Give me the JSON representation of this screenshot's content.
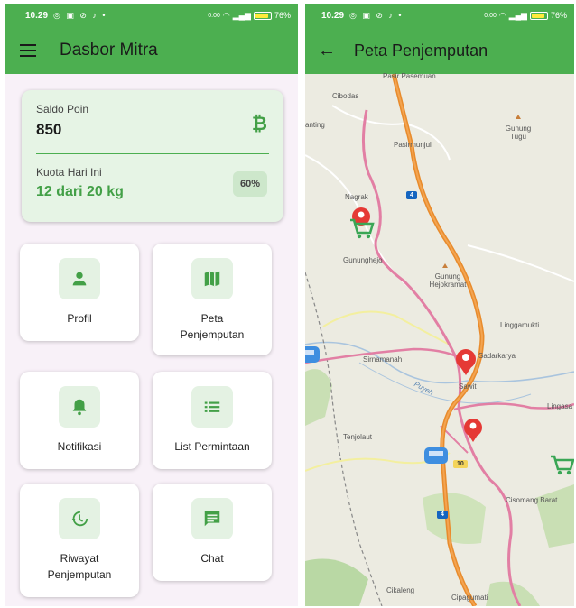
{
  "status_bar": {
    "time": "10.29",
    "network_speed": "0.00",
    "battery": "76%"
  },
  "left_screen": {
    "title": "Dasbor Mitra",
    "saldo": {
      "label": "Saldo Poin",
      "value": "850"
    },
    "quota": {
      "label": "Kuota Hari Ini",
      "value": "12 dari 20 kg",
      "percent_label": "60%",
      "percent": 0.6
    },
    "menu": [
      {
        "id": "profil",
        "label": "Profil",
        "icon": "person-icon"
      },
      {
        "id": "peta",
        "label": "Peta\nPenjemputan",
        "icon": "map-icon"
      },
      {
        "id": "notifikasi",
        "label": "Notifikasi",
        "icon": "bell-icon"
      },
      {
        "id": "list",
        "label": "List Permintaan",
        "icon": "list-icon"
      },
      {
        "id": "riwayat",
        "label": "Riwayat\nPenjemputan",
        "icon": "history-icon"
      },
      {
        "id": "chat",
        "label": "Chat",
        "icon": "chat-icon"
      }
    ]
  },
  "right_screen": {
    "title": "Peta Penjemputan",
    "places": [
      "Pasir Pasemuan",
      "Cibodas",
      "anting",
      "Pasirmunjul",
      "Gunung Tugu",
      "Nagrak",
      "Gununghejo",
      "Gunung Hejokramat",
      "Linggamukti",
      "Sirnamanah",
      "Sadarkarya",
      "Sawit",
      "Lingasa",
      "Tenjolaut",
      "Cisomang Barat",
      "Cikaleng",
      "Cipagumati",
      "Puyeh"
    ],
    "road_numbers": [
      "4",
      "10",
      "4"
    ]
  },
  "colors": {
    "primary": "#4caf50",
    "road_toll": "#e88b2c",
    "road_main": "#e27fa4",
    "marker": "#e53935"
  }
}
